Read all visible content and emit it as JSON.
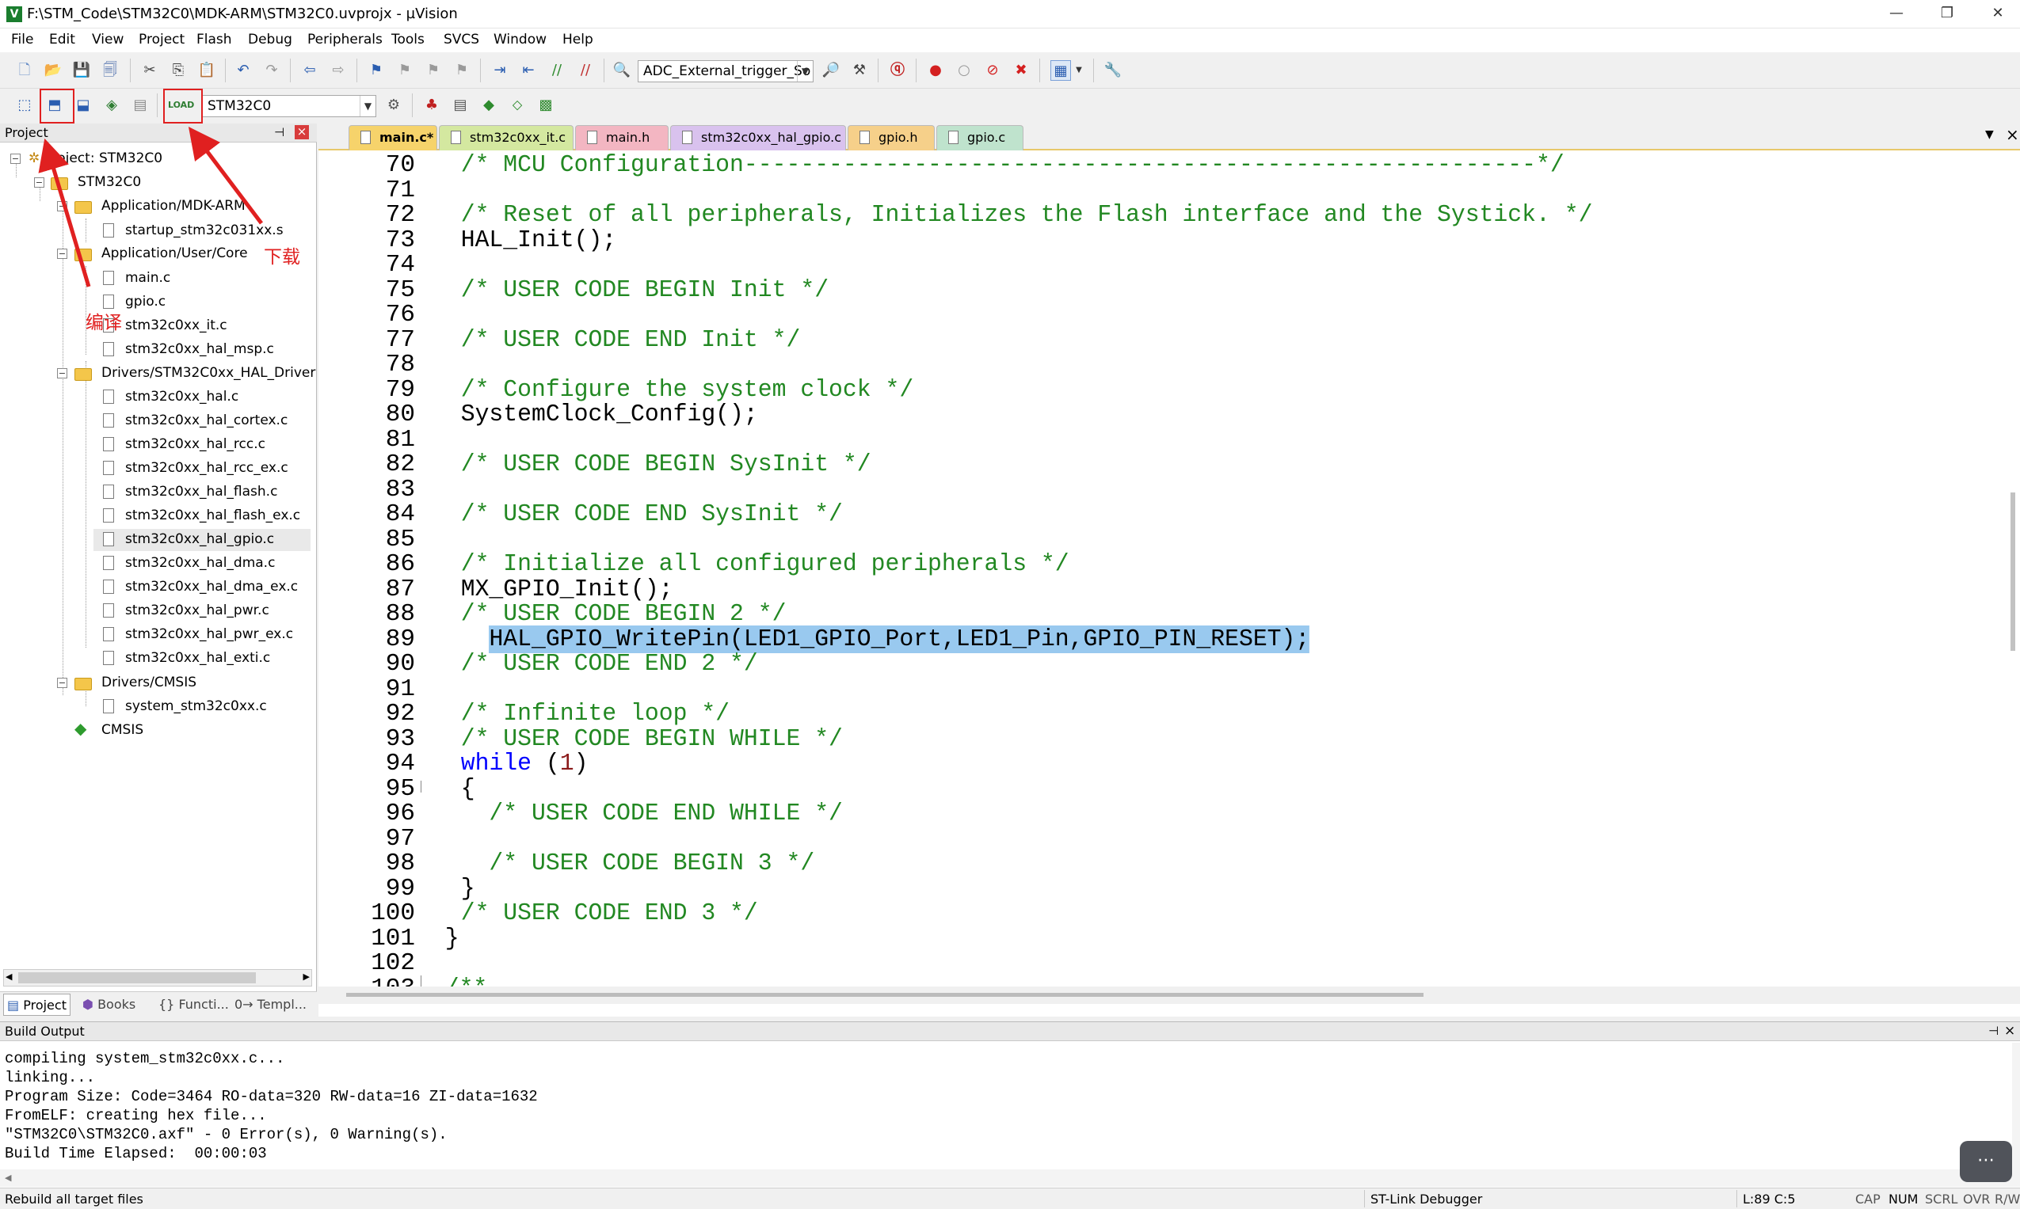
{
  "window": {
    "title": "F:\\STM_Code\\STM32C0\\MDK-ARM\\STM32C0.uvprojx - µVision",
    "app_icon": "V",
    "controls": [
      "—",
      "❐",
      "✕"
    ]
  },
  "menu": [
    "File",
    "Edit",
    "View",
    "Project",
    "Flash",
    "Debug",
    "Peripherals",
    "Tools",
    "SVCS",
    "Window",
    "Help"
  ],
  "toolbar": {
    "find_combo_value": "ADC_External_trigger_So",
    "target_combo_value": "STM32C0"
  },
  "project_panel": {
    "title": "Project",
    "pin": "⊣",
    "close": "×",
    "root": "Project: STM32C0",
    "target": "STM32C0",
    "groups": [
      {
        "name": "Application/MDK-ARM",
        "files": [
          "startup_stm32c031xx.s"
        ]
      },
      {
        "name": "Application/User/Core",
        "files": [
          "main.c",
          "gpio.c",
          "stm32c0xx_it.c",
          "stm32c0xx_hal_msp.c"
        ]
      },
      {
        "name": "Drivers/STM32C0xx_HAL_Driver",
        "files": [
          "stm32c0xx_hal.c",
          "stm32c0xx_hal_cortex.c",
          "stm32c0xx_hal_rcc.c",
          "stm32c0xx_hal_rcc_ex.c",
          "stm32c0xx_hal_flash.c",
          "stm32c0xx_hal_flash_ex.c",
          "stm32c0xx_hal_gpio.c",
          "stm32c0xx_hal_dma.c",
          "stm32c0xx_hal_dma_ex.c",
          "stm32c0xx_hal_pwr.c",
          "stm32c0xx_hal_pwr_ex.c",
          "stm32c0xx_hal_exti.c"
        ]
      },
      {
        "name": "Drivers/CMSIS",
        "files": [
          "system_stm32c0xx.c"
        ]
      }
    ],
    "extra": "CMSIS",
    "tabs": [
      "Project",
      "Books",
      "{} Functi...",
      "0→ Templ..."
    ]
  },
  "editor": {
    "tabs": [
      {
        "label": "main.c*",
        "color": "#f6d36b",
        "active": true
      },
      {
        "label": "stm32c0xx_it.c",
        "color": "#d4e8a0"
      },
      {
        "label": "main.h",
        "color": "#f3b6c2"
      },
      {
        "label": "stm32c0xx_hal_gpio.c",
        "color": "#d9c2ee"
      },
      {
        "label": "gpio.h",
        "color": "#f6d08a"
      },
      {
        "label": "gpio.c",
        "color": "#bfe3cd"
      }
    ],
    "tab_menu": "▼",
    "tab_close": "×",
    "lines": [
      {
        "n": "70",
        "t": "/* MCU Configuration--------------------------------------------------------*/",
        "c": "cm"
      },
      {
        "n": "71",
        "t": "",
        "c": ""
      },
      {
        "n": "72",
        "t": "/* Reset of all peripherals, Initializes the Flash interface and the Systick. */",
        "c": "cm"
      },
      {
        "n": "73",
        "t": "HAL_Init();",
        "c": ""
      },
      {
        "n": "74",
        "t": "",
        "c": ""
      },
      {
        "n": "75",
        "t": "/* USER CODE BEGIN Init */",
        "c": "cm"
      },
      {
        "n": "76",
        "t": "",
        "c": ""
      },
      {
        "n": "77",
        "t": "/* USER CODE END Init */",
        "c": "cm"
      },
      {
        "n": "78",
        "t": "",
        "c": ""
      },
      {
        "n": "79",
        "t": "/* Configure the system clock */",
        "c": "cm"
      },
      {
        "n": "80",
        "t": "SystemClock_Config();",
        "c": ""
      },
      {
        "n": "81",
        "t": "",
        "c": ""
      },
      {
        "n": "82",
        "t": "/* USER CODE BEGIN SysInit */",
        "c": "cm"
      },
      {
        "n": "83",
        "t": "",
        "c": ""
      },
      {
        "n": "84",
        "t": "/* USER CODE END SysInit */",
        "c": "cm"
      },
      {
        "n": "85",
        "t": "",
        "c": ""
      },
      {
        "n": "86",
        "t": "/* Initialize all configured peripherals */",
        "c": "cm"
      },
      {
        "n": "87",
        "t": "MX_GPIO_Init();",
        "c": ""
      },
      {
        "n": "88",
        "t": "/* USER CODE BEGIN 2 */",
        "c": "cm"
      },
      {
        "n": "89",
        "t": "  HAL_GPIO_WritePin(LED1_GPIO_Port,LED1_Pin,GPIO_PIN_RESET);",
        "c": "hl"
      },
      {
        "n": "90",
        "t": "/* USER CODE END 2 */",
        "c": "cm"
      },
      {
        "n": "91",
        "t": "",
        "c": ""
      },
      {
        "n": "92",
        "t": "/* Infinite loop */",
        "c": "cm"
      },
      {
        "n": "93",
        "t": "/* USER CODE BEGIN WHILE */",
        "c": "cm"
      },
      {
        "n": "94",
        "t": "while (1)",
        "c": "while"
      },
      {
        "n": "95",
        "t": "{",
        "c": ""
      },
      {
        "n": "96",
        "t": "  /* USER CODE END WHILE */",
        "c": "cm"
      },
      {
        "n": "97",
        "t": "",
        "c": ""
      },
      {
        "n": "98",
        "t": "  /* USER CODE BEGIN 3 */",
        "c": "cm"
      },
      {
        "n": "99",
        "t": "}",
        "c": ""
      },
      {
        "n": "100",
        "t": "/* USER CODE END 3 */",
        "c": "cm"
      },
      {
        "n": "101",
        "t": "}",
        "c": "outer"
      },
      {
        "n": "102",
        "t": "",
        "c": ""
      },
      {
        "n": "103",
        "t": "/**",
        "c": "outercm"
      }
    ]
  },
  "build_output": {
    "title": "Build Output",
    "lines": [
      "compiling system_stm32c0xx.c...",
      "linking...",
      "Program Size: Code=3464 RO-data=320 RW-data=16 ZI-data=1632",
      "FromELF: creating hex file...",
      "\"STM32C0\\STM32C0.axf\" - 0 Error(s), 0 Warning(s).",
      "Build Time Elapsed:  00:00:03"
    ]
  },
  "status": {
    "message": "Rebuild all target files",
    "debugger": "ST-Link Debugger",
    "position": "L:89 C:5",
    "caps": "CAP",
    "num": "NUM",
    "scrl": "SCRL",
    "ovr": "OVR",
    "rw": "R/W"
  },
  "annotations": {
    "compile": "编译",
    "download": "下载",
    "color": "#e02020"
  }
}
